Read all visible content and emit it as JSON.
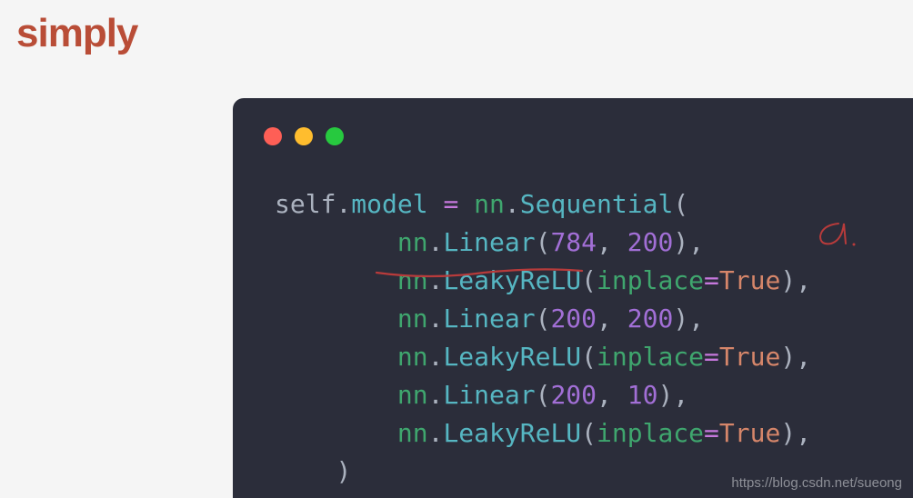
{
  "heading": "simply",
  "watermark": "https://blog.csdn.net/sueong",
  "code": {
    "parts": {
      "self": "self",
      "dot": ".",
      "model": "model",
      "space": " ",
      "eq": "=",
      "nn": "nn",
      "Sequential": "Sequential",
      "lparen": "(",
      "rparen": ")",
      "comma": ",",
      "Linear": "Linear",
      "LeakyReLU": "LeakyReLU",
      "inplace": "inplace",
      "True": "True",
      "n784": "784",
      "n200": "200",
      "n10": "10",
      "indent1": "    ",
      "indent2": "        "
    }
  }
}
